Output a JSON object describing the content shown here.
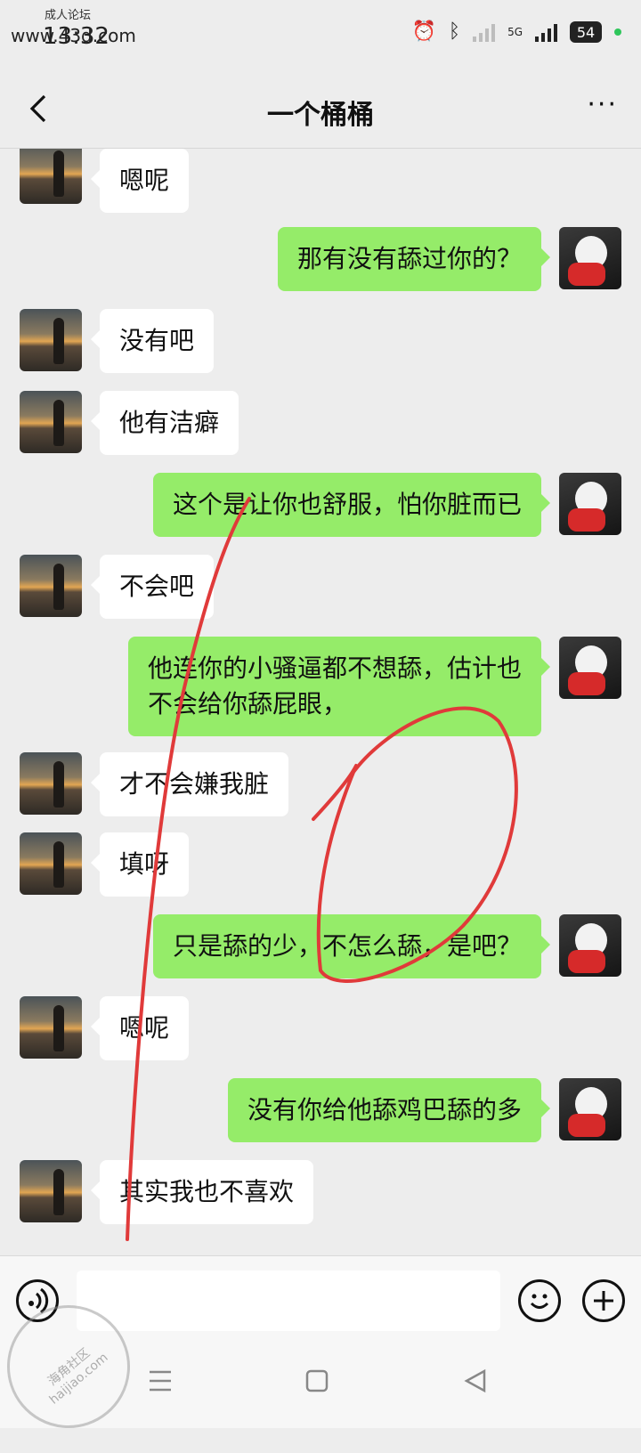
{
  "status_bar": {
    "watermark_top": "成人论坛",
    "watermark_site": "www.43d.com",
    "time": "13:32",
    "battery": "54",
    "network": "5G"
  },
  "nav": {
    "back_icon": "chevron-left-icon",
    "title": "一个桶桶",
    "more_label": "···"
  },
  "messages": [
    {
      "side": "left",
      "text": "嗯呢"
    },
    {
      "side": "right",
      "text": "那有没有舔过你的？"
    },
    {
      "side": "left",
      "text": "没有吧"
    },
    {
      "side": "left",
      "text": "他有洁癖"
    },
    {
      "side": "right",
      "text": "这个是让你也舒服，怕你脏而已"
    },
    {
      "side": "left",
      "text": "不会吧"
    },
    {
      "side": "right",
      "text": "他连你的小骚逼都不想舔，估计也\n不会给你舔屁眼，"
    },
    {
      "side": "left",
      "text": "才不会嫌我脏"
    },
    {
      "side": "left",
      "text": "填呀"
    },
    {
      "side": "right",
      "text": "只是舔的少，不怎么舔，是吧？"
    },
    {
      "side": "left",
      "text": "嗯呢"
    },
    {
      "side": "right",
      "text": "没有你给他舔鸡巴舔的多"
    },
    {
      "side": "left",
      "text": "其实我也不喜欢"
    }
  ],
  "annotation_color": "#e03a3a",
  "input_bar": {
    "voice_icon": "voice-icon",
    "input_value": "",
    "emoji_icon": "emoji-icon",
    "plus_icon": "plus-icon"
  },
  "system_nav": {
    "menu_icon": "menu-icon",
    "home_icon": "home-icon",
    "back_icon": "back-triangle-icon"
  },
  "stamp": {
    "text": "海角社区 haijiao.com"
  }
}
